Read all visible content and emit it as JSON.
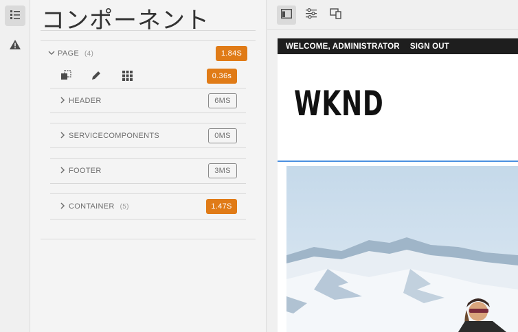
{
  "rail": {
    "items": [
      {
        "icon": "list-icon",
        "active": true
      },
      {
        "icon": "warning-icon",
        "active": false
      }
    ]
  },
  "panel": {
    "title": "コンポーネント",
    "page": {
      "label": "PAGE",
      "count": "(4)",
      "time": "1.84S"
    },
    "tools_time": "0.36s",
    "children": [
      {
        "label": "HEADER",
        "count": "",
        "time": "6MS",
        "style": "outline"
      },
      {
        "label": "SERVICECOMPONENTS",
        "count": "",
        "time": "0MS",
        "style": "outline"
      },
      {
        "label": "FOOTER",
        "count": "",
        "time": "3MS",
        "style": "outline"
      },
      {
        "label": "CONTAINER",
        "count": "(5)",
        "time": "1.47S",
        "style": "orange"
      }
    ]
  },
  "topbar": {
    "buttons": [
      {
        "icon": "layout-icon",
        "active": true
      },
      {
        "icon": "sliders-icon",
        "active": false
      },
      {
        "icon": "devices-icon",
        "active": false
      }
    ]
  },
  "preview": {
    "welcome": "WELCOME, ADMINISTRATOR",
    "sign_out": "SIGN OUT",
    "logo": "WKND"
  },
  "colors": {
    "accent_orange": "#e07b17",
    "selection_blue": "#4a8fe0"
  }
}
